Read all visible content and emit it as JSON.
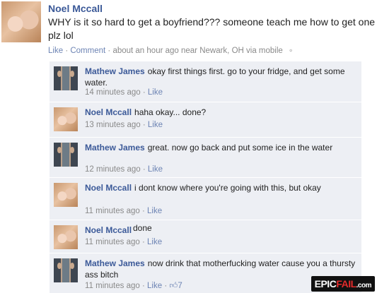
{
  "post": {
    "author": "Noel Mccall",
    "text": "WHY is it so hard to get a boyfriend??? someone teach me how to get one plz lol",
    "like_label": "Like",
    "comment_label": "Comment",
    "meta_text": "about an hour ago near Newark, OH via mobile",
    "mobile_icon": "mobile-icon"
  },
  "comments": [
    {
      "author": "Mathew James",
      "text": "okay first things first. go to your fridge, and get some water.",
      "time": "14 minutes ago",
      "like_label": "Like",
      "avatar": "mathew"
    },
    {
      "author": "Noel Mccall",
      "text": "haha okay... done?",
      "time": "13 minutes ago",
      "like_label": "Like",
      "avatar": "noel"
    },
    {
      "author": "Mathew James",
      "text": "great. now go back and put some ice in the water",
      "time": "12 minutes ago",
      "like_label": "Like",
      "avatar": "mathew"
    },
    {
      "author": "Noel Mccall",
      "text": "i dont know where you're going with this, but okay",
      "time": "11 minutes ago",
      "like_label": "Like",
      "avatar": "noel"
    },
    {
      "author": "Noel Mccall",
      "text": "done",
      "time": "11 minutes ago",
      "like_label": "Like",
      "avatar": "noel"
    },
    {
      "author": "Mathew James",
      "text": "now drink that motherfucking water cause you a thursty ass bitch",
      "time": "11 minutes ago",
      "like_label": "Like",
      "avatar": "mathew",
      "like_count": "7"
    }
  ],
  "watermark": {
    "part1": "EPIC",
    "part2": "FAIL",
    "part3": ".com"
  },
  "colors": {
    "link": "#3b5998",
    "meta_link": "#6d84b4",
    "comment_bg": "#edeff4",
    "watermark_red": "#e32b2b"
  }
}
